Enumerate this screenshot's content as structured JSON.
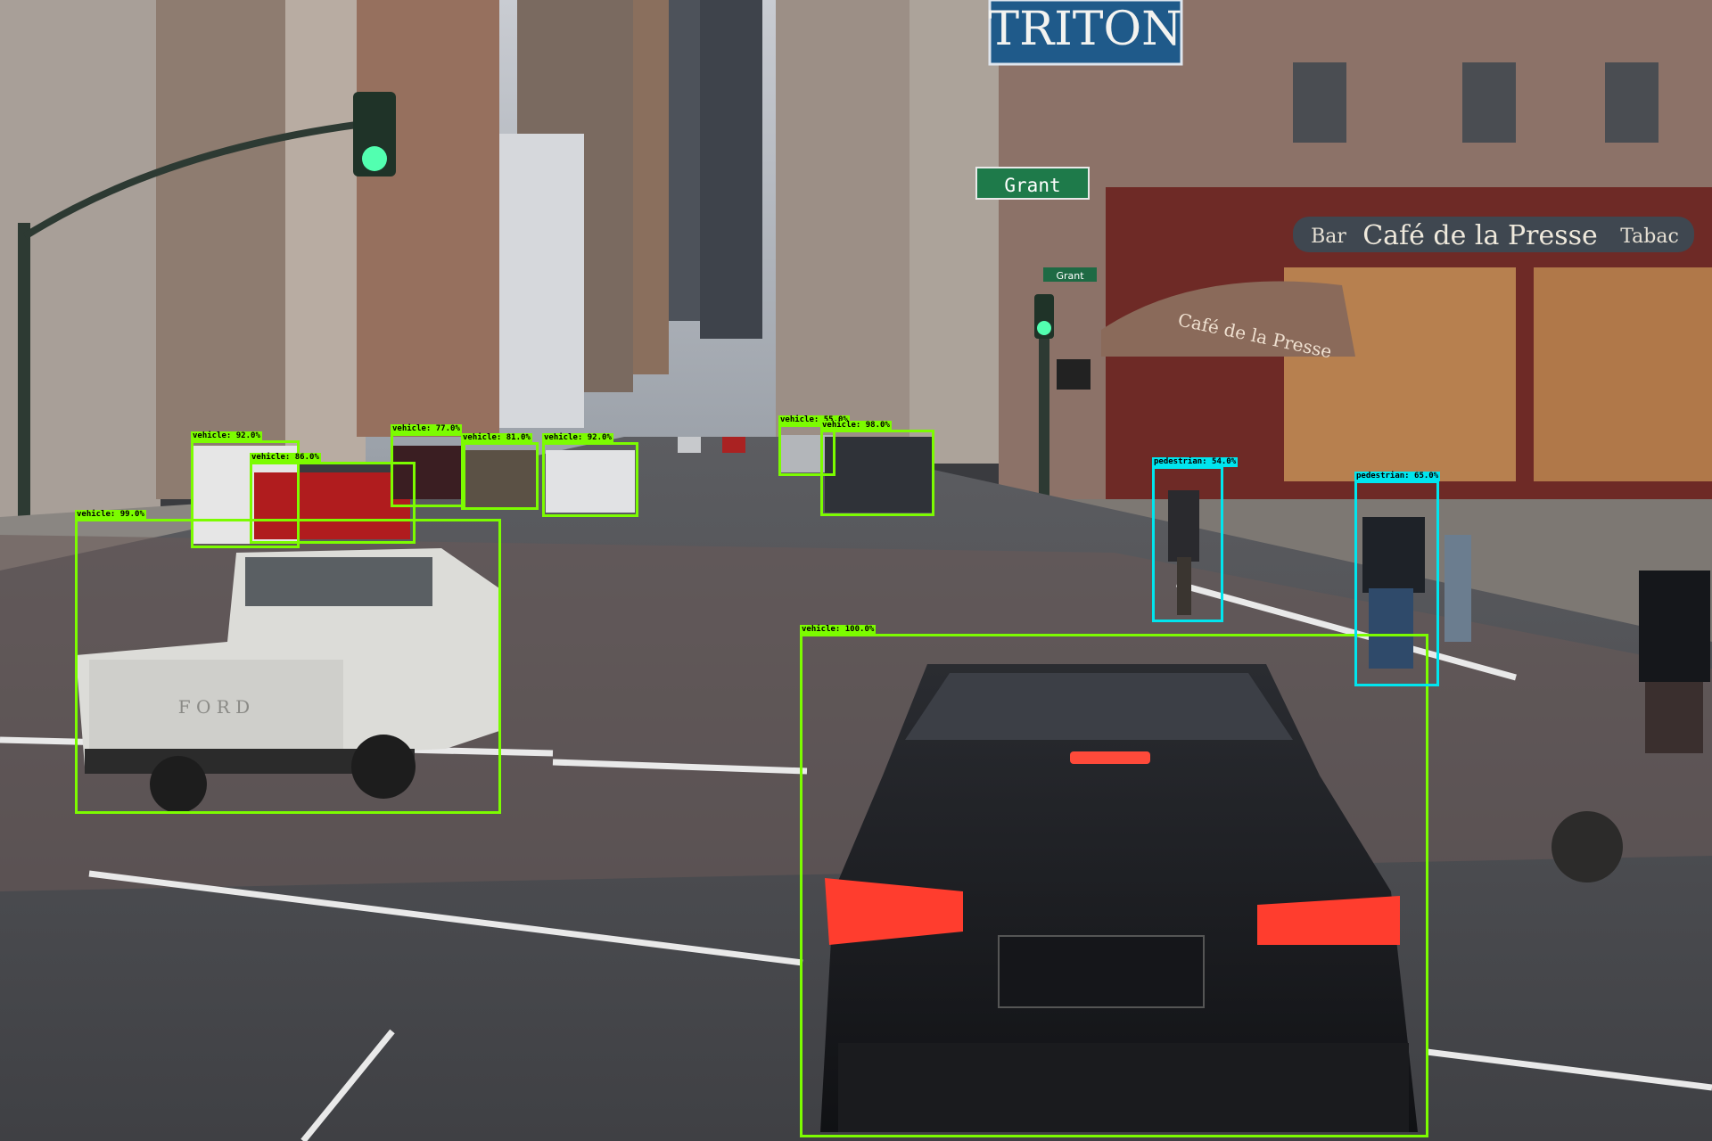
{
  "scene": {
    "signs": {
      "hotel": "TRITON",
      "street": "Grant",
      "small_street": "Grant",
      "cafe": "Café de la Presse",
      "cafe_left": "Bar",
      "cafe_right": "Tabac",
      "awning": "Café de la Presse",
      "truck_tailgate": "F O R D"
    }
  },
  "detections": [
    {
      "label": "vehicle: 92.0%",
      "class": "vehicle"
    },
    {
      "label": "vehicle: 86.0%",
      "class": "vehicle"
    },
    {
      "label": "vehicle: 77.0%",
      "class": "vehicle"
    },
    {
      "label": "vehicle: 81.0%",
      "class": "vehicle"
    },
    {
      "label": "vehicle: 92.0%",
      "class": "vehicle"
    },
    {
      "label": "vehicle: 55.0%",
      "class": "vehicle"
    },
    {
      "label": "vehicle: 98.0%",
      "class": "vehicle"
    },
    {
      "label": "vehicle: 99.0%",
      "class": "vehicle"
    },
    {
      "label": "vehicle: 100.0%",
      "class": "vehicle"
    },
    {
      "label": "pedestrian: 54.0%",
      "class": "pedestrian"
    },
    {
      "label": "pedestrian: 65.0%",
      "class": "pedestrian"
    }
  ],
  "colors": {
    "vehicle_box": "#7cfc00",
    "pedestrian_box": "#00e5ee"
  }
}
